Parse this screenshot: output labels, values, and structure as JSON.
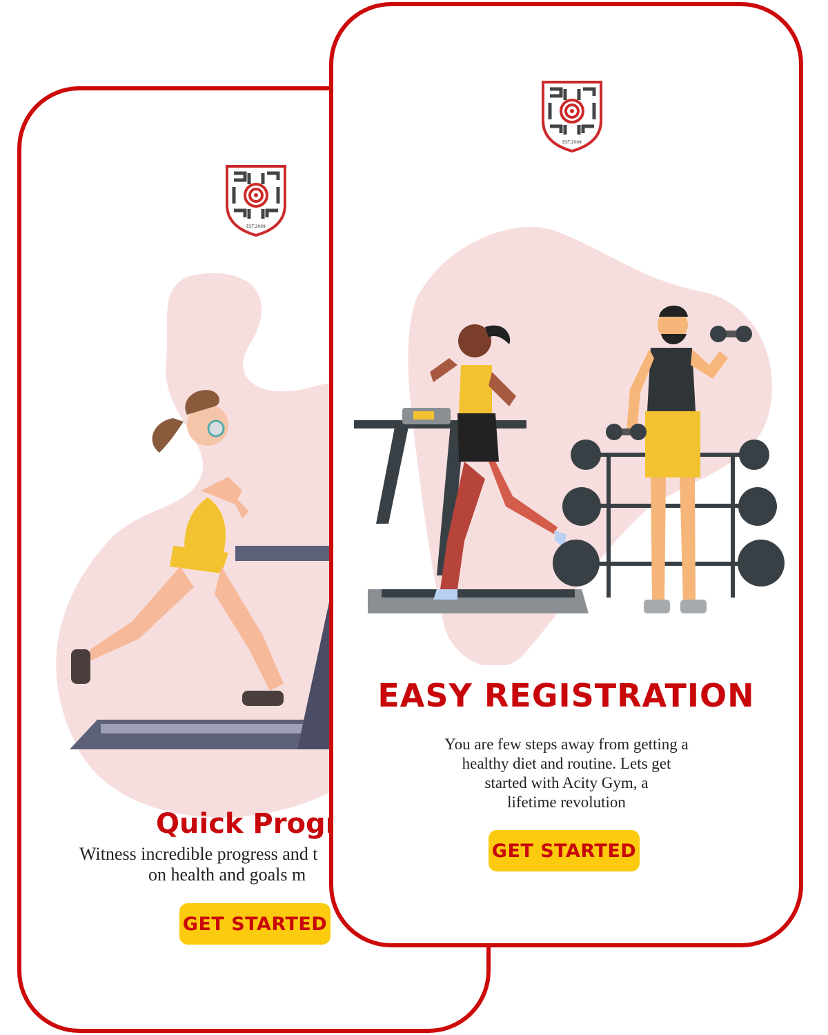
{
  "screens": {
    "back": {
      "logo_text": "EST.2009",
      "title": "Quick Progre",
      "description_lines": [
        "Witness incredible progress and t",
        "on health and goals m"
      ],
      "button_label": "GET STARTED"
    },
    "front": {
      "logo_text": "EST.2009",
      "title": "EASY REGISTRATION",
      "description_lines": [
        "You are few steps away from getting a",
        "healthy diet and routine. Lets get",
        "started with Acity Gym, a",
        "lifetime revolution"
      ],
      "button_label": "GET STARTED"
    }
  },
  "colors": {
    "brand_red": "#cc0a0a",
    "title_red": "#c8070b",
    "button_yellow": "#fccb0f",
    "blob_pink": "#f7dede"
  },
  "icons": {
    "logo": "gym-shield-logo-icon",
    "back_illustration": "woman-on-treadmill-illustration",
    "front_illustration": "treadmill-and-dumbbell-man-illustration"
  }
}
